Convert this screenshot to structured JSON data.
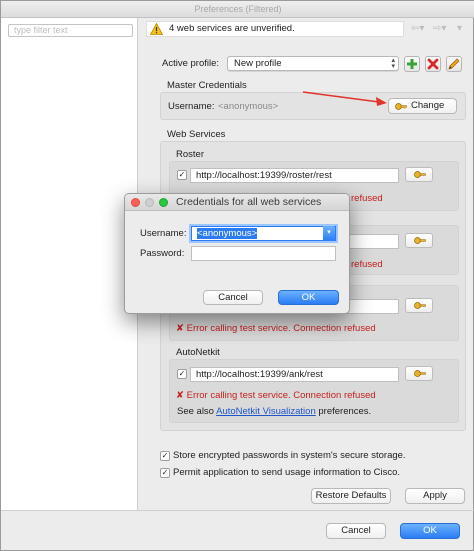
{
  "window": {
    "title": "Preferences (Filtered)"
  },
  "sidebar": {
    "filter_placeholder": "type filter text"
  },
  "message": {
    "text": "4 web services are unverified.",
    "icon": "warning-icon"
  },
  "profile": {
    "label": "Active profile:",
    "value": "New profile",
    "add_icon": "plus-icon",
    "remove_icon": "x-icon",
    "edit_icon": "pencil-icon"
  },
  "master": {
    "title": "Master Credentials",
    "username_label": "Username:",
    "username_value": "<anonymous>",
    "change_label": "Change"
  },
  "web_services": {
    "title": "Web Services",
    "roster": {
      "title": "Roster",
      "url": "http://localhost:19399/roster/rest",
      "error": "refused"
    },
    "service2": {
      "error": "refused"
    },
    "service3": {
      "error": "refused"
    },
    "service4": {
      "error": "Error calling test service. Connection refused"
    },
    "autonetkit": {
      "title": "AutoNetkit",
      "url": "http://localhost:19399/ank/rest",
      "error": "Error calling test service. Connection refused",
      "see_also": "See also",
      "link": "AutoNetkit Visualization",
      "suffix": "preferences."
    }
  },
  "options": {
    "store_passwords": "Store encrypted passwords in system's secure storage.",
    "usage_info": "Permit application to send usage information to Cisco."
  },
  "buttons": {
    "restore": "Restore Defaults",
    "apply": "Apply",
    "cancel": "Cancel",
    "ok": "OK"
  },
  "dialog": {
    "title": "Credentials for all web services",
    "username_label": "Username:",
    "username_value": "<anonymous>",
    "password_label": "Password:",
    "cancel": "Cancel",
    "ok": "OK"
  },
  "colors": {
    "accent": "#2b7cf3",
    "error": "#c62020",
    "link": "#1f55c8",
    "arrow": "#e0352b"
  }
}
